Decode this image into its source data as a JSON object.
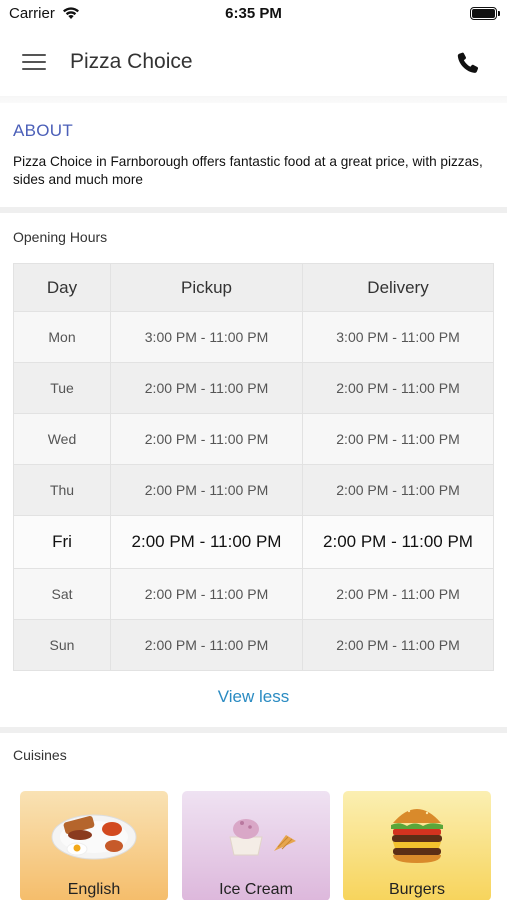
{
  "status_bar": {
    "carrier": "Carrier",
    "time": "6:35 PM"
  },
  "header": {
    "title": "Pizza Choice",
    "icons": {
      "menu": "hamburger-menu-icon",
      "call": "phone-icon"
    }
  },
  "about": {
    "title": "ABOUT",
    "text": "Pizza Choice in Farnborough offers fantastic food at a great price, with pizzas, sides and much more"
  },
  "opening_hours": {
    "label": "Opening Hours",
    "columns": [
      "Day",
      "Pickup",
      "Delivery"
    ],
    "rows": [
      {
        "day": "Mon",
        "pickup": "3:00 PM - 11:00 PM",
        "delivery": "3:00 PM - 11:00 PM"
      },
      {
        "day": "Tue",
        "pickup": "2:00 PM - 11:00 PM",
        "delivery": "2:00 PM - 11:00 PM"
      },
      {
        "day": "Wed",
        "pickup": "2:00 PM - 11:00 PM",
        "delivery": "2:00 PM - 11:00 PM"
      },
      {
        "day": "Thu",
        "pickup": "2:00 PM - 11:00 PM",
        "delivery": "2:00 PM - 11:00 PM"
      },
      {
        "day": "Fri",
        "pickup": "2:00 PM - 11:00 PM",
        "delivery": "2:00 PM - 11:00 PM",
        "highlighted": true
      },
      {
        "day": "Sat",
        "pickup": "2:00 PM - 11:00 PM",
        "delivery": "2:00 PM - 11:00 PM"
      },
      {
        "day": "Sun",
        "pickup": "2:00 PM - 11:00 PM",
        "delivery": "2:00 PM - 11:00 PM"
      }
    ],
    "toggle_label": "View less"
  },
  "cuisines": {
    "label": "Cuisines",
    "items": [
      {
        "name": "English",
        "icon": "english-breakfast-image"
      },
      {
        "name": "Ice Cream",
        "icon": "ice-cream-image"
      },
      {
        "name": "Burgers",
        "icon": "burger-image"
      }
    ]
  },
  "colors": {
    "accent_about": "#4b5fb8",
    "link": "#2a8bc2"
  }
}
